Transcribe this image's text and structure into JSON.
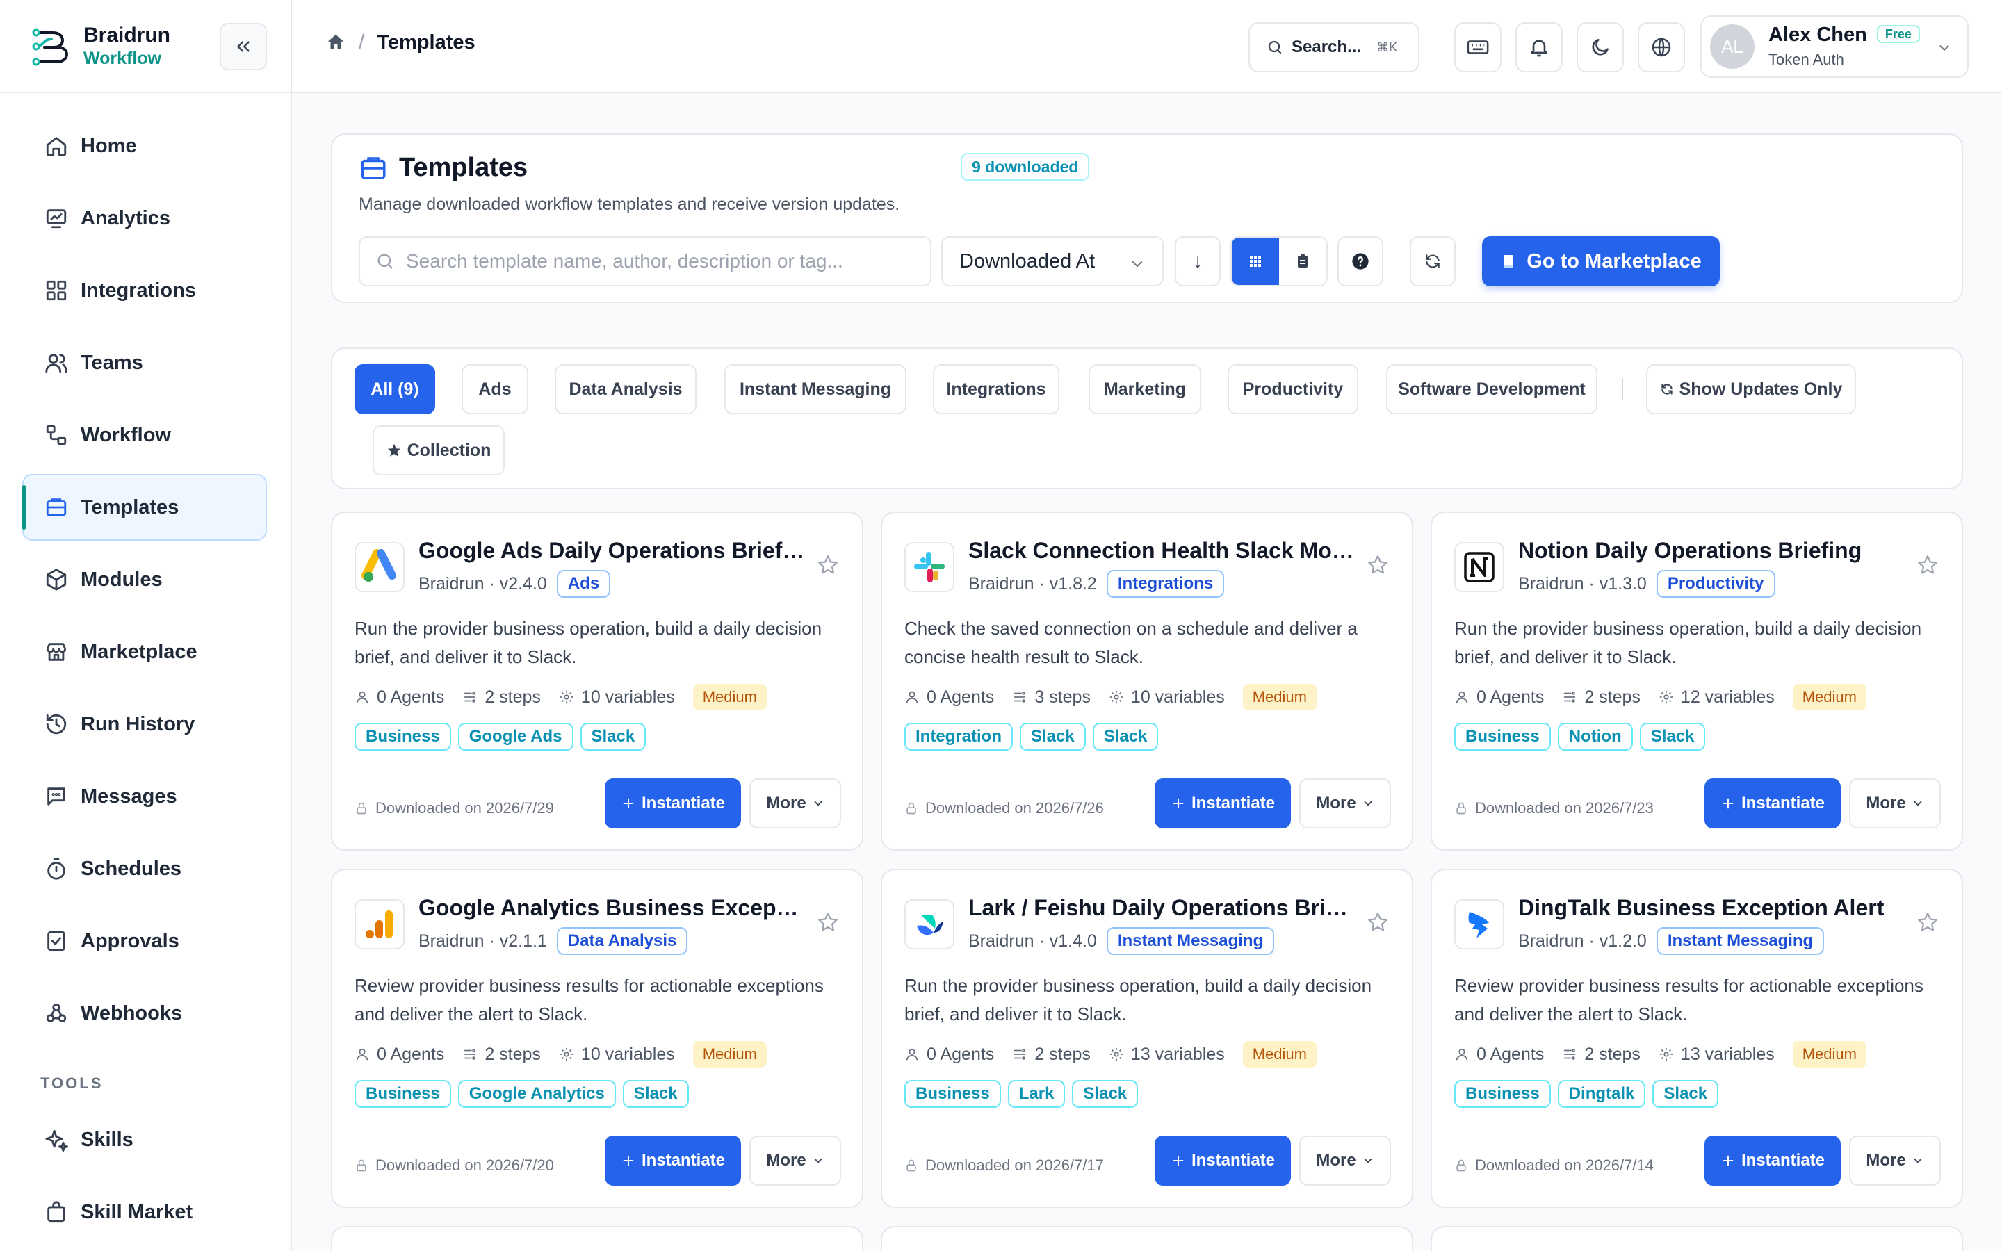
{
  "brand": {
    "name": "Braidrun",
    "sub": "Workflow"
  },
  "sidebar": {
    "items": [
      {
        "label": "Home",
        "icon": "home-icon"
      },
      {
        "label": "Analytics",
        "icon": "analytics-icon"
      },
      {
        "label": "Integrations",
        "icon": "integrations-icon"
      },
      {
        "label": "Teams",
        "icon": "teams-icon"
      },
      {
        "label": "Workflow",
        "icon": "workflow-icon"
      },
      {
        "label": "Templates",
        "icon": "templates-icon",
        "active": true
      },
      {
        "label": "Modules",
        "icon": "modules-icon"
      },
      {
        "label": "Marketplace",
        "icon": "marketplace-icon"
      },
      {
        "label": "Run History",
        "icon": "history-icon"
      },
      {
        "label": "Messages",
        "icon": "messages-icon"
      },
      {
        "label": "Schedules",
        "icon": "timer-icon"
      },
      {
        "label": "Approvals",
        "icon": "approvals-icon"
      },
      {
        "label": "Webhooks",
        "icon": "webhooks-icon"
      }
    ],
    "tools_label": "TOOLS",
    "tools": [
      {
        "label": "Skills",
        "icon": "sparkle-icon"
      },
      {
        "label": "Skill Market",
        "icon": "bag-icon"
      }
    ]
  },
  "topbar": {
    "breadcrumb_current": "Templates",
    "breadcrumb_sep": "/",
    "search_label": "Search...",
    "search_shortcut": "⌘K",
    "user": {
      "initials": "AL",
      "name": "Alex Chen",
      "plan": "Free",
      "auth": "Token Auth"
    }
  },
  "header": {
    "title": "Templates",
    "badge": "9 downloaded",
    "description": "Manage downloaded workflow templates and receive version updates.",
    "search_placeholder": "Search template name, author, description or tag...",
    "sort_value": "Downloaded At",
    "sort_dir_glyph": "↓",
    "marketplace_button": "Go to Marketplace"
  },
  "filters": {
    "chips": [
      "All (9)",
      "Ads",
      "Data Analysis",
      "Instant Messaging",
      "Integrations",
      "Marketing",
      "Productivity",
      "Software Development"
    ],
    "updates_only": "Show Updates Only",
    "collection": "Collection"
  },
  "cards": [
    {
      "title": "Google Ads Daily Operations Briefing",
      "author": "Braidrun",
      "version": "v2.4.0",
      "category": "Ads",
      "description": "Run the provider business operation, build a daily decision brief, and deliver it to Slack.",
      "agents": "0 Agents",
      "steps": "2 steps",
      "variables": "10 variables",
      "level": "Medium",
      "tags": [
        "Business",
        "Google Ads",
        "Slack"
      ],
      "downloaded": "Downloaded on 2026/7/29",
      "logo": "google-ads"
    },
    {
      "title": "Slack Connection Health Slack Monitor",
      "author": "Braidrun",
      "version": "v1.8.2",
      "category": "Integrations",
      "description": "Check the saved connection on a schedule and deliver a concise health result to Slack.",
      "agents": "0 Agents",
      "steps": "3 steps",
      "variables": "10 variables",
      "level": "Medium",
      "tags": [
        "Integration",
        "Slack",
        "Slack"
      ],
      "downloaded": "Downloaded on 2026/7/26",
      "logo": "slack"
    },
    {
      "title": "Notion Daily Operations Briefing",
      "author": "Braidrun",
      "version": "v1.3.0",
      "category": "Productivity",
      "description": "Run the provider business operation, build a daily decision brief, and deliver it to Slack.",
      "agents": "0 Agents",
      "steps": "2 steps",
      "variables": "12 variables",
      "level": "Medium",
      "tags": [
        "Business",
        "Notion",
        "Slack"
      ],
      "downloaded": "Downloaded on 2026/7/23",
      "logo": "notion"
    },
    {
      "title": "Google Analytics Business Exception Alert",
      "author": "Braidrun",
      "version": "v2.1.1",
      "category": "Data Analysis",
      "description": "Review provider business results for actionable exceptions and deliver the alert to Slack.",
      "agents": "0 Agents",
      "steps": "2 steps",
      "variables": "10 variables",
      "level": "Medium",
      "tags": [
        "Business",
        "Google Analytics",
        "Slack"
      ],
      "downloaded": "Downloaded on 2026/7/20",
      "logo": "google-analytics"
    },
    {
      "title": "Lark / Feishu Daily Operations Briefing",
      "author": "Braidrun",
      "version": "v1.4.0",
      "category": "Instant Messaging",
      "description": "Run the provider business operation, build a daily decision brief, and deliver it to Slack.",
      "agents": "0 Agents",
      "steps": "2 steps",
      "variables": "13 variables",
      "level": "Medium",
      "tags": [
        "Business",
        "Lark",
        "Slack"
      ],
      "downloaded": "Downloaded on 2026/7/17",
      "logo": "lark"
    },
    {
      "title": "DingTalk Business Exception Alert",
      "author": "Braidrun",
      "version": "v1.2.0",
      "category": "Instant Messaging",
      "description": "Review provider business results for actionable exceptions and deliver the alert to Slack.",
      "agents": "0 Agents",
      "steps": "2 steps",
      "variables": "13 variables",
      "level": "Medium",
      "tags": [
        "Business",
        "Dingtalk",
        "Slack"
      ],
      "downloaded": "Downloaded on 2026/7/14",
      "logo": "dingtalk"
    }
  ],
  "card_actions": {
    "instantiate": "Instantiate",
    "more": "More"
  },
  "colors": {
    "primary": "#2563eb",
    "accent": "#0d9488",
    "medium_bg": "#fef3c7",
    "medium_fg": "#b45309"
  }
}
